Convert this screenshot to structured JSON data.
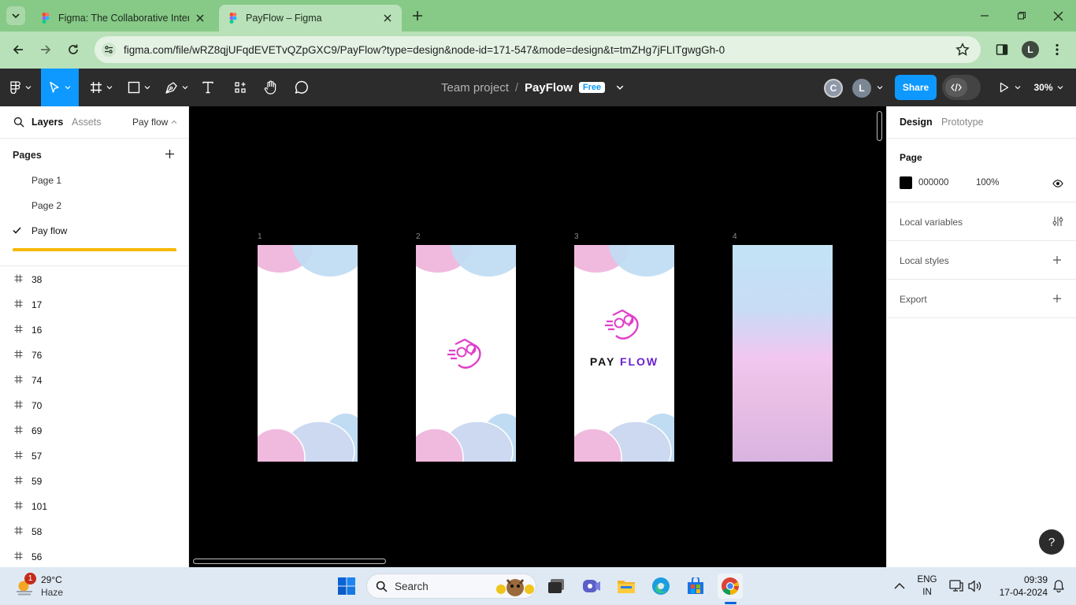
{
  "browser": {
    "tabs": [
      {
        "title": "Figma: The Collaborative Interf",
        "active": false
      },
      {
        "title": "PayFlow – Figma",
        "active": true
      }
    ],
    "url": "figma.com/file/wRZ8qjUFqdEVETvQZpGXC9/PayFlow?type=design&node-id=171-547&mode=design&t=tmZHg7jFLITgwgGh-0",
    "profile_initial": "L"
  },
  "toolbar": {
    "breadcrumb_team": "Team project",
    "breadcrumb_sep": "/",
    "file_name": "PayFlow",
    "plan_badge": "Free",
    "avatars": [
      "C",
      "L"
    ],
    "share_label": "Share",
    "zoom": "30%"
  },
  "left_panel": {
    "tabs": [
      "Layers",
      "Assets"
    ],
    "page_selector": "Pay flow",
    "pages_heading": "Pages",
    "pages": [
      {
        "name": "Page 1",
        "selected": false
      },
      {
        "name": "Page 2",
        "selected": false
      },
      {
        "name": "Pay flow",
        "selected": true
      }
    ],
    "layers": [
      "38",
      "17",
      "16",
      "76",
      "74",
      "70",
      "69",
      "57",
      "59",
      "101",
      "58",
      "56"
    ]
  },
  "canvas": {
    "frames": [
      {
        "label": "1"
      },
      {
        "label": "2"
      },
      {
        "label": "3",
        "logo_text_a": "PAY",
        "logo_text_b": "FLOW"
      },
      {
        "label": "4"
      }
    ]
  },
  "right_panel": {
    "tabs": [
      "Design",
      "Prototype"
    ],
    "page_heading": "Page",
    "page_color": "000000",
    "page_opacity": "100%",
    "sections": [
      "Local variables",
      "Local styles",
      "Export"
    ],
    "help": "?"
  },
  "taskbar": {
    "weather_temp": "29°C",
    "weather_desc": "Haze",
    "weather_badge": "1",
    "search_label": "Search",
    "lang_top": "ENG",
    "lang_bottom": "IN",
    "time": "09:39",
    "date": "17-04-2024"
  },
  "colors": {
    "tabbar": "#87c987",
    "addressbar": "#b9e1b9",
    "figma_toolbar": "#2c2c2c",
    "share_button": "#0d99ff",
    "accent_yellow": "#f5b800",
    "logo_pink": "#e040c8",
    "logo_purple": "#6a1fd0"
  }
}
